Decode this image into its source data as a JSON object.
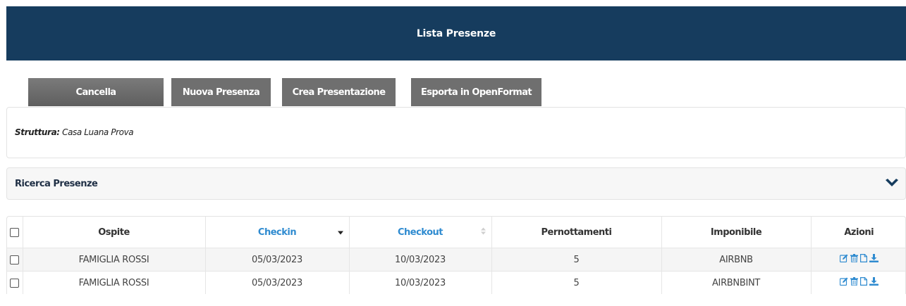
{
  "header": {
    "title": "Lista Presenze"
  },
  "toolbar": {
    "buttons": [
      {
        "label": "Cancella"
      },
      {
        "label": "Nuova Presenza"
      },
      {
        "label": "Crea Presentazione"
      },
      {
        "label": "Esporta in OpenFormat"
      }
    ]
  },
  "struttura": {
    "label": "Struttura:",
    "value": "Casa Luana Prova"
  },
  "search": {
    "title": "Ricerca Presenze"
  },
  "table": {
    "columns": [
      "Ospite",
      "Checkin",
      "Checkout",
      "Pernottamenti",
      "Imponibile",
      "Azioni"
    ],
    "rows": [
      {
        "ospite": "FAMIGLIA ROSSI",
        "checkin": "05/03/2023",
        "checkout": "10/03/2023",
        "pernottamenti": "5",
        "imponibile": "AIRBNB"
      },
      {
        "ospite": "FAMIGLIA ROSSI",
        "checkin": "05/03/2023",
        "checkout": "10/03/2023",
        "pernottamenti": "5",
        "imponibile": "AIRBNBINT"
      }
    ],
    "sorted_column": "Checkin",
    "sort_direction": "descending"
  },
  "icons": {
    "edit": "edit-icon",
    "delete": "trash-icon",
    "document": "document-icon",
    "download": "download-icon",
    "expand": "chevron-down-icon"
  },
  "colors": {
    "header_bg": "#163c5e",
    "button_bg": "#6f6f6f",
    "link": "#2f8bd0"
  }
}
